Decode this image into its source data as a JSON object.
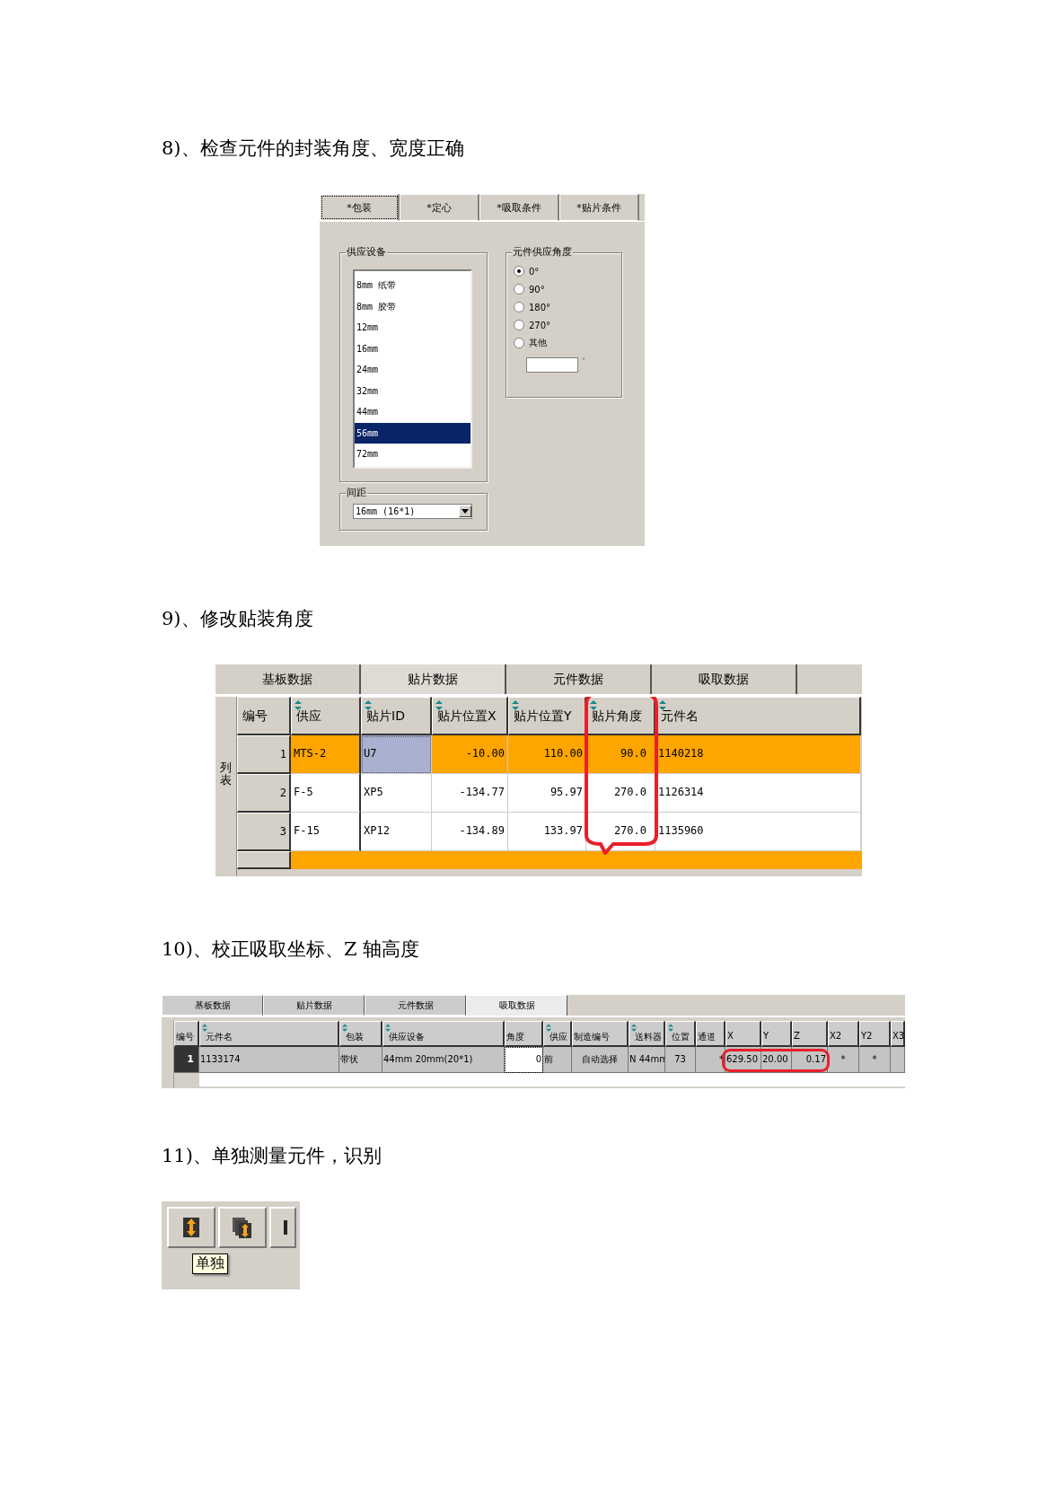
{
  "sections": [
    {
      "kind": "package",
      "heading": "8)、检查元件的封装角度、宽度正确",
      "tabs": [
        {
          "label": "*包装",
          "selected": true
        },
        {
          "label": "*定心",
          "selected": false
        },
        {
          "label": "*吸取条件",
          "selected": false
        },
        {
          "label": "*贴片条件",
          "selected": false
        }
      ],
      "supply_group": {
        "title": "供应设备",
        "items": [
          {
            "label": "8mm 纸带",
            "selected": false
          },
          {
            "label": "8mm 胶带",
            "selected": false
          },
          {
            "label": "12mm",
            "selected": false
          },
          {
            "label": "16mm",
            "selected": false
          },
          {
            "label": "24mm",
            "selected": false
          },
          {
            "label": "32mm",
            "selected": false
          },
          {
            "label": "44mm",
            "selected": false
          },
          {
            "label": "56mm",
            "selected": true
          },
          {
            "label": "72mm",
            "selected": false
          }
        ]
      },
      "pitch_group": {
        "title": "间距",
        "value": "16mm (16*1)"
      },
      "angle_group": {
        "title": "元件供应角度",
        "options": [
          {
            "label": "0°",
            "selected": true
          },
          {
            "label": "90°",
            "selected": false
          },
          {
            "label": "180°",
            "selected": false
          },
          {
            "label": "270°",
            "selected": false
          },
          {
            "label": "其他",
            "selected": false
          }
        ],
        "unit": "°"
      }
    },
    {
      "kind": "placement",
      "heading": "9)、修改贴装角度",
      "tabs": [
        {
          "label": "基板数据",
          "selected": false
        },
        {
          "label": "贴片数据",
          "selected": true
        },
        {
          "label": "元件数据",
          "selected": false
        },
        {
          "label": "吸取数据",
          "selected": false
        }
      ],
      "side_label": "列表",
      "columns": [
        {
          "label": "编号",
          "sortable": false
        },
        {
          "label": "供应",
          "sortable": true
        },
        {
          "label": "贴片ID",
          "sortable": true
        },
        {
          "label": "贴片位置X",
          "sortable": true
        },
        {
          "label": "贴片位置Y",
          "sortable": true
        },
        {
          "label": "贴片角度",
          "sortable": true
        },
        {
          "label": "元件名",
          "sortable": true
        }
      ],
      "rows": [
        {
          "cells": [
            "1",
            "MTS-2",
            "U7",
            "-10.00",
            "110.00",
            "90.0",
            "1140218"
          ],
          "selected": true,
          "id_focused": true
        },
        {
          "cells": [
            "2",
            "F-5",
            "XP5",
            "-134.77",
            "95.97",
            "270.0",
            "1126314"
          ],
          "selected": false,
          "id_focused": false
        },
        {
          "cells": [
            "3",
            "F-15",
            "XP12",
            "-134.89",
            "133.97",
            "270.0",
            "1135960"
          ],
          "selected": false,
          "id_focused": false
        }
      ],
      "partial_row": {
        "selected": true
      }
    },
    {
      "kind": "pickup",
      "heading": "10)、校正吸取坐标、Z 轴高度",
      "tabs": [
        {
          "label": "基板数据",
          "selected": false
        },
        {
          "label": "贴片数据",
          "selected": false
        },
        {
          "label": "元件数据",
          "selected": false
        },
        {
          "label": "吸取数据",
          "selected": true
        }
      ],
      "columns": [
        {
          "label": "编号",
          "sortable": false
        },
        {
          "label": "元件名",
          "sortable": true
        },
        {
          "label": "包装",
          "sortable": true
        },
        {
          "label": "供应设备",
          "sortable": true
        },
        {
          "label": "角度",
          "sortable": false
        },
        {
          "label": "供应",
          "sortable": true
        },
        {
          "label": "制造编号",
          "sortable": false
        },
        {
          "label": "送料器",
          "sortable": true
        },
        {
          "label": "位置",
          "sortable": true
        },
        {
          "label": "通道",
          "sortable": false
        },
        {
          "label": "X",
          "sortable": false
        },
        {
          "label": "Y",
          "sortable": false
        },
        {
          "label": "Z",
          "sortable": false
        },
        {
          "label": "X2",
          "sortable": false
        },
        {
          "label": "Y2",
          "sortable": false
        },
        {
          "label": "X3",
          "sortable": false
        }
      ],
      "rows": [
        {
          "cells": [
            "1",
            "1133174",
            "带状",
            "44mm 20mm(20*1)",
            "0",
            "前",
            "自动选择",
            "N 44mm",
            "73",
            "*",
            "629.50",
            "20.00",
            "0.17",
            "*",
            "*"
          ],
          "selected": true
        }
      ]
    },
    {
      "kind": "toolbar",
      "heading": "11)、单独测量元件，识别",
      "buttons": [
        {
          "kind": "single"
        },
        {
          "kind": "multiple"
        },
        {
          "kind": "partial"
        }
      ],
      "tooltip": "单独"
    }
  ]
}
